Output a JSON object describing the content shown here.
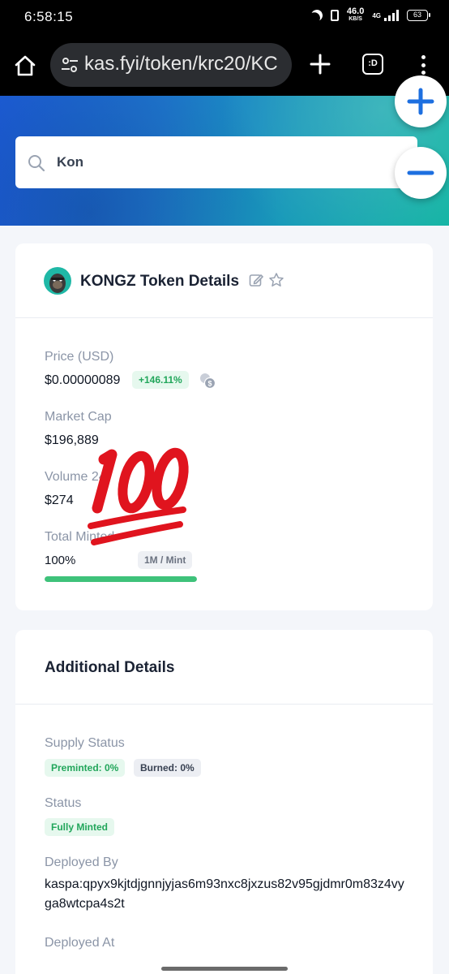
{
  "status_bar": {
    "time": "6:58:15",
    "net_speed": "46.0",
    "net_unit": "KB/S",
    "network": "4G",
    "battery": "63"
  },
  "browser": {
    "url": "kas.fyi/token/krc20/KC",
    "tab_label": ":D"
  },
  "search": {
    "value": "Kon"
  },
  "token_card": {
    "title": "KONGZ Token Details",
    "price_label": "Price  (USD)",
    "price_value": "$0.00000089",
    "price_change": "+146.11%",
    "market_cap_label": "Market Cap",
    "market_cap_value": "$196,889",
    "volume_label": "Volume 24",
    "volume_value": "$274",
    "total_minted_label": "Total Minted",
    "total_minted_value": "100%",
    "mint_limit": "1M / Mint",
    "minted_progress": 1.0
  },
  "additional_card": {
    "title": "Additional Details",
    "supply_status_label": "Supply Status",
    "preminted": "Preminted: 0%",
    "burned": "Burned: 0%",
    "status_label": "Status",
    "status_value": "Fully Minted",
    "deployed_by_label": "Deployed By",
    "deployed_by_value": "kaspa:qpyx9kjtdjgnnjyjas6m93nxc8jxzus82v95gjdmr0m83z4vyga8wtcpa4s2t",
    "deployed_at_label": "Deployed At"
  },
  "colors": {
    "accent": "#1d6fe0",
    "positive": "#22a65b",
    "progress": "#3ec27a"
  }
}
